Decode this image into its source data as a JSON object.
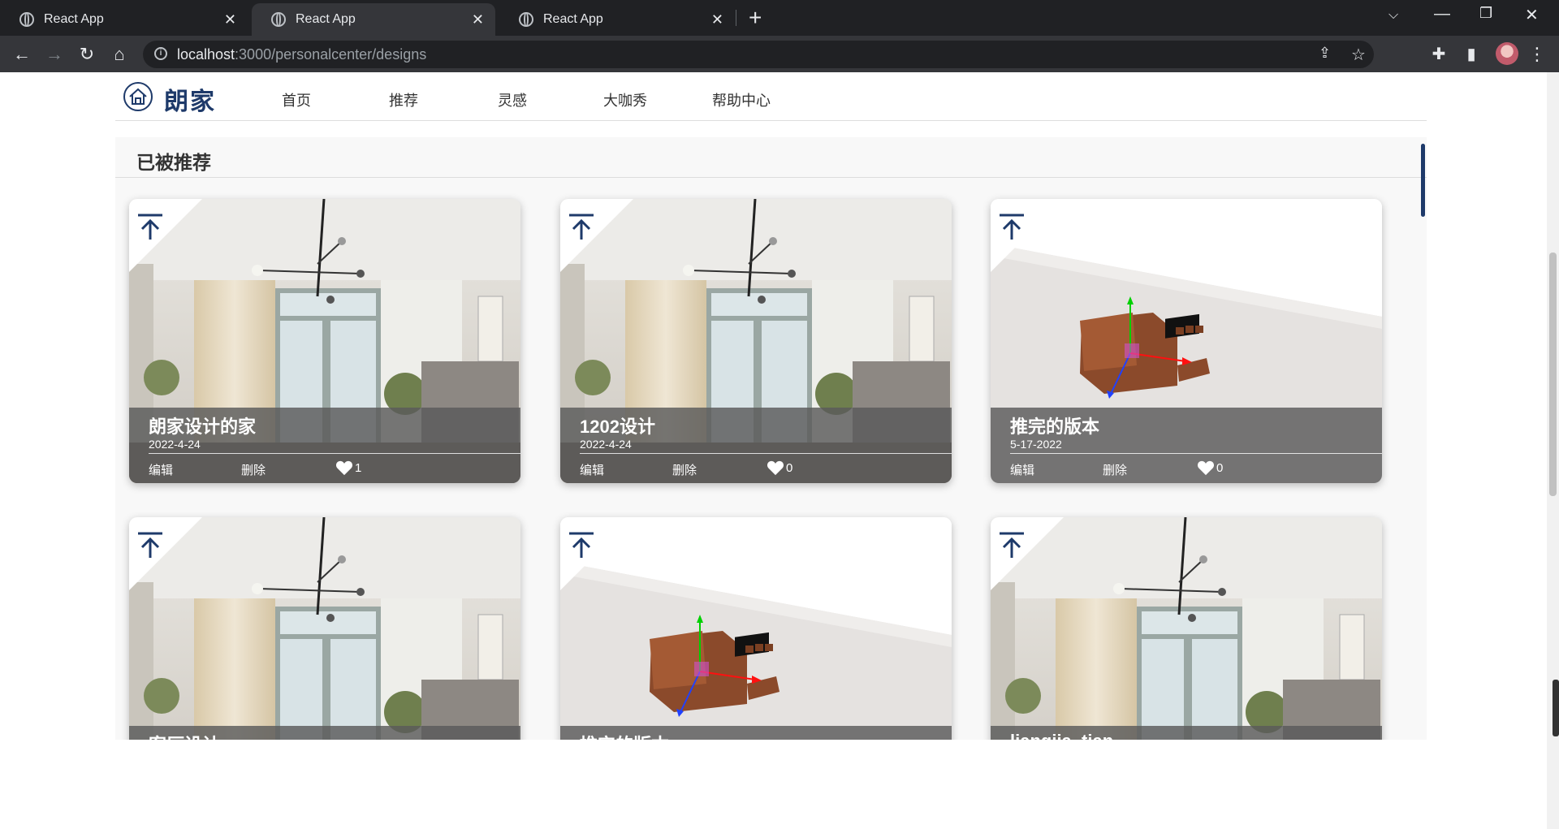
{
  "browser": {
    "tabs": [
      {
        "title": "React App"
      },
      {
        "title": "React App"
      },
      {
        "title": "React App"
      }
    ],
    "url_host": "localhost",
    "url_path": ":3000/personalcenter/designs"
  },
  "site": {
    "brand": "朗家",
    "nav": [
      "首页",
      "推荐",
      "灵感",
      "大咖秀",
      "帮助中心"
    ]
  },
  "section": {
    "title": "已被推荐"
  },
  "actions": {
    "edit": "编辑",
    "delete": "删除"
  },
  "cards": [
    {
      "title": "朗家设计的家",
      "date": "2022-4-24",
      "likes": "1",
      "image": "living-room-photo"
    },
    {
      "title": "1202设计",
      "date": "2022-4-24",
      "likes": "0",
      "image": "living-room-photo"
    },
    {
      "title": "推完的版本",
      "date": "5-17-2022",
      "likes": "0",
      "image": "3d-furniture-render"
    },
    {
      "title": "客厅设计",
      "date": "",
      "likes": "",
      "image": "living-room-photo"
    },
    {
      "title": "推完的版本",
      "date": "",
      "likes": "",
      "image": "3d-furniture-render"
    },
    {
      "title": "liangjia_tian",
      "date": "",
      "likes": "",
      "image": "living-room-photo"
    }
  ]
}
